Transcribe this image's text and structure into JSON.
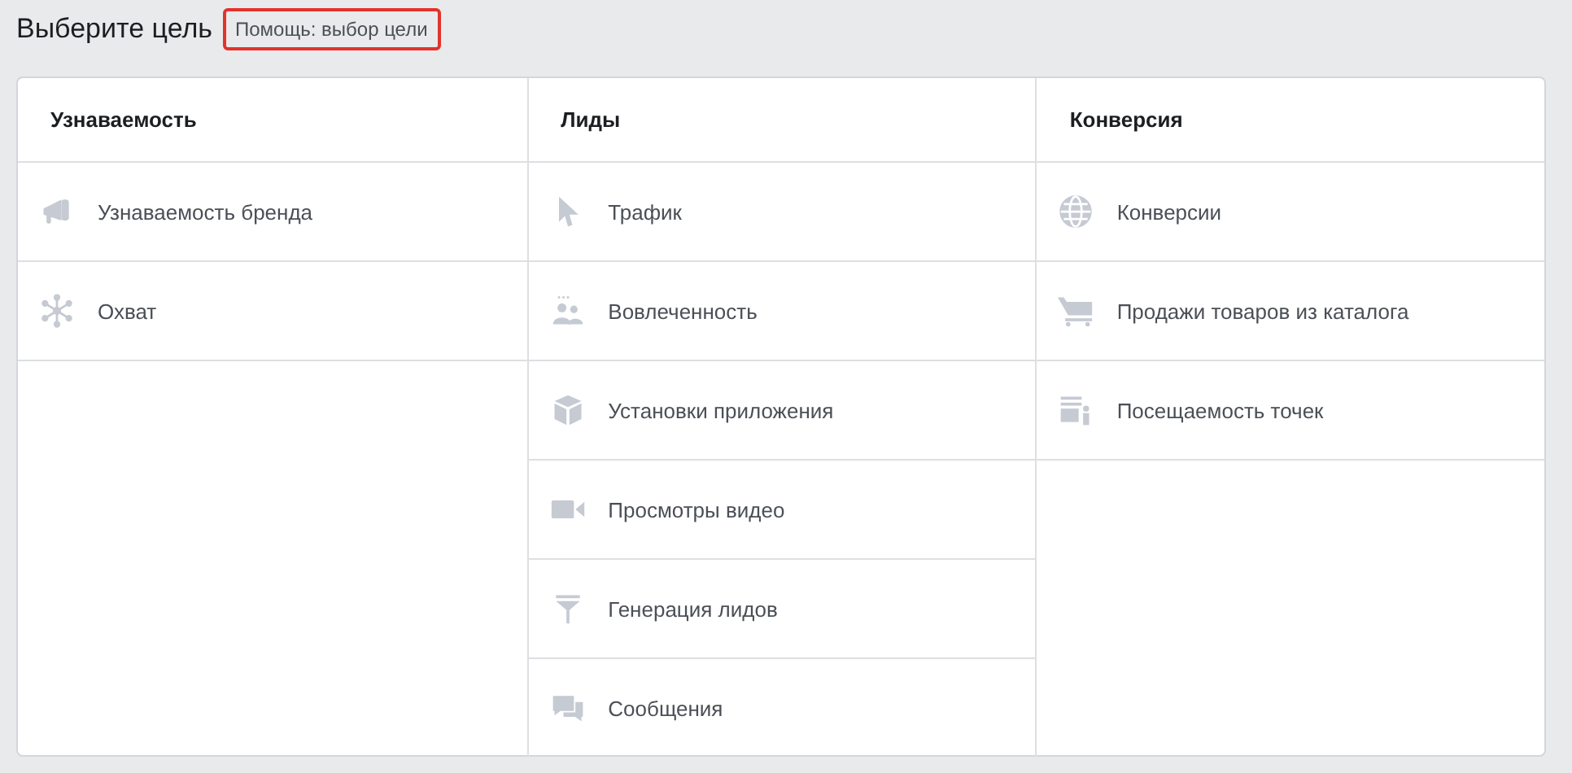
{
  "title": "Выберите цель",
  "help_link": {
    "label": "Помощь: выбор цели",
    "highlighted": true
  },
  "columns": [
    {
      "heading": "Узнаваемость",
      "items": [
        "Узнаваемость бренда",
        "Охват"
      ]
    },
    {
      "heading": "Лиды",
      "items": [
        "Трафик",
        "Вовлеченность",
        "Установки приложения",
        "Просмотры видео",
        "Генерация лидов",
        "Сообщения"
      ]
    },
    {
      "heading": "Конверсия",
      "items": [
        "Конверсии",
        "Продажи товаров из каталога",
        "Посещаемость точек"
      ]
    }
  ]
}
